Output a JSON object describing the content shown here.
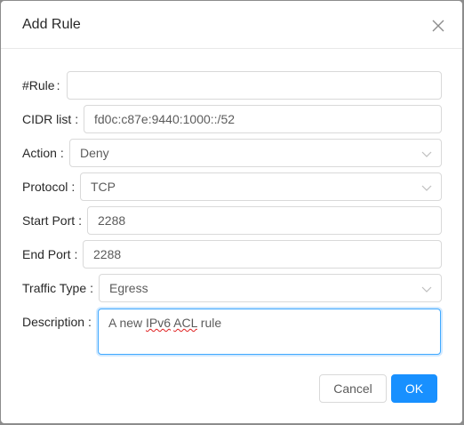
{
  "dialog": {
    "title": "Add Rule",
    "close_icon": "close-icon"
  },
  "form": {
    "rule": {
      "label": "#Rule",
      "value": ""
    },
    "cidr": {
      "label": "CIDR list",
      "value": "fd0c:c87e:9440:1000::/52"
    },
    "action": {
      "label": "Action",
      "value": "Deny"
    },
    "protocol": {
      "label": "Protocol",
      "value": "TCP"
    },
    "start_port": {
      "label": "Start Port",
      "value": "2288"
    },
    "end_port": {
      "label": "End Port",
      "value": "2288"
    },
    "traffic_type": {
      "label": "Traffic Type",
      "value": "Egress"
    },
    "description": {
      "label": "Description",
      "value_prefix": "A new ",
      "value_word1": "IPv6",
      "value_space": " ",
      "value_word2": "ACL",
      "value_suffix": " rule"
    },
    "colon": ":"
  },
  "footer": {
    "cancel_label": "Cancel",
    "ok_label": "OK"
  },
  "colors": {
    "primary": "#1890ff",
    "focus_border": "#40a9ff"
  }
}
